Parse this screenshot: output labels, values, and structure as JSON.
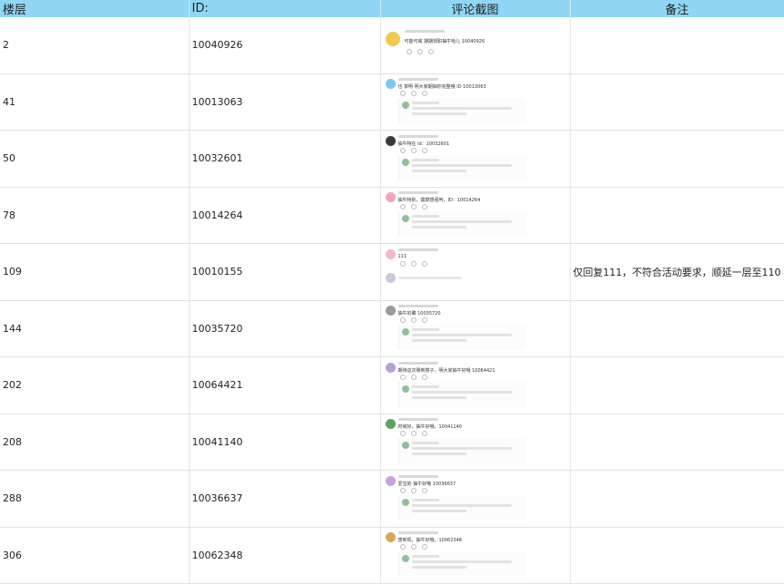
{
  "headers": {
    "floor": "楼层",
    "id": "ID:",
    "screenshot": "评论截图",
    "note": "备注"
  },
  "rows": [
    {
      "floor": "2",
      "id": "10040926",
      "note": "",
      "shot": {
        "text": "可能可威 期期现职抽牛哈儿 10040926",
        "reply": false
      }
    },
    {
      "floor": "41",
      "id": "10013063",
      "note": "",
      "shot": {
        "text": "也 挚明 明大家期抽你完整哦 ID 10013063",
        "reply": true
      }
    },
    {
      "floor": "50",
      "id": "10032601",
      "note": "",
      "shot": {
        "text": "抽牛特在 id：10032601",
        "reply": true
      }
    },
    {
      "floor": "78",
      "id": "10014264",
      "note": "",
      "shot": {
        "text": "抽牛特别，震撼感强呵，ID：10014264",
        "reply": true
      }
    },
    {
      "floor": "109",
      "id": "10010155",
      "note": "仅回复111，不符合活动要求，顺延一层至110",
      "shot": {
        "text": "111",
        "reply": false
      }
    },
    {
      "floor": "144",
      "id": "10035720",
      "note": "",
      "shot": {
        "text": "抽牛的确 10035720",
        "reply": true
      }
    },
    {
      "floor": "202",
      "id": "10064421",
      "note": "",
      "shot": {
        "text": "期待这次赐到楼子，明大家抽牛好哦 10064421",
        "reply": true
      }
    },
    {
      "floor": "208",
      "id": "10041140",
      "note": "",
      "shot": {
        "text": "时候好，抽牛好哦，10041140",
        "reply": true
      }
    },
    {
      "floor": "288",
      "id": "10036637",
      "note": "",
      "shot": {
        "text": "爱宝的 抽牛好哦 10036637",
        "reply": true
      }
    },
    {
      "floor": "306",
      "id": "10062348",
      "note": "",
      "shot": {
        "text": "感到现，抽牛好哦，10062348",
        "reply": true
      }
    }
  ],
  "colors": {
    "header_bg": "#8fd7f5",
    "grid": "#e3e3e3"
  }
}
